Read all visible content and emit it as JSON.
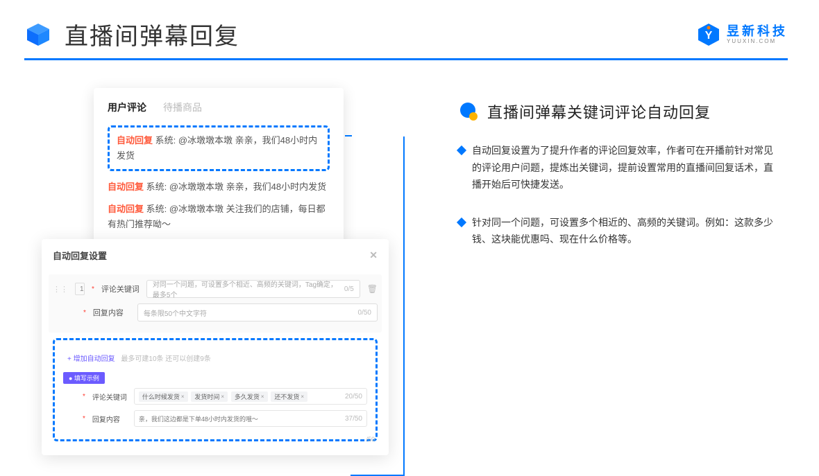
{
  "header": {
    "title": "直播间弹幕回复",
    "brand_top": "昱新科技",
    "brand_bottom": "YUUXIN.COM"
  },
  "panel1": {
    "tab_active": "用户评论",
    "tab_inactive": "待播商品",
    "auto_tag": "自动回复",
    "row1": "系统: @冰墩墩本墩 亲亲，我们48小时内发货",
    "row2": "系统: @冰墩墩本墩 亲亲，我们48小时内发货",
    "row3": "系统: @冰墩墩本墩 关注我们的店铺，每日都有热门推荐呦～"
  },
  "panel2": {
    "title": "自动回复设置",
    "num": "1",
    "label_kw": "评论关键词",
    "placeholder_kw": "对同一个问题，可设置多个相近、高频的关键词，Tag确定，最多5个",
    "count_kw": "0/5",
    "label_content": "回复内容",
    "placeholder_content": "每条限50个中文字符",
    "count_content": "0/50",
    "add_label": "+ 增加自动回复",
    "add_hint": "最多可建10条 还可以创建9条",
    "example_badge": "● 填写示例",
    "ex_label_kw": "评论关键词",
    "ex_tags": [
      "什么时候发货",
      "发货时间",
      "多久发货",
      "还不发货"
    ],
    "ex_count_kw": "20/50",
    "ex_label_content": "回复内容",
    "ex_content": "亲，我们这边都是下单48小时内发货的哦～",
    "ex_count_content": "37/50",
    "stray": "/50"
  },
  "right": {
    "sec_title": "直播间弹幕关键词评论自动回复",
    "bullet1": "自动回复设置为了提升作者的评论回复效率，作者可在开播前针对常见的评论用户问题，提炼出关键词，提前设置常用的直播间回复话术，直播开始后可快捷发送。",
    "bullet2": "针对同一个问题，可设置多个相近的、高频的关键词。例如：这款多少钱、这块能优惠吗、现在什么价格等。"
  }
}
